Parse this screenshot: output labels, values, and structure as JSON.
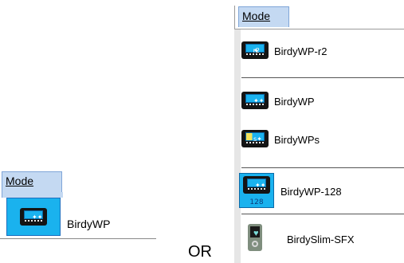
{
  "left_menu": {
    "header": "Mode",
    "item": {
      "label": "BirdyWP",
      "icon": "pager-icon"
    }
  },
  "or_text": "OR",
  "right_menu": {
    "header": "Mode",
    "items": [
      {
        "label": "BirdyWP-r2",
        "icon": "pager-r2-icon"
      },
      {
        "label": "BirdyWP",
        "icon": "pager-icon"
      },
      {
        "label": "BirdyWPs",
        "icon": "pager-s-icon"
      },
      {
        "label": "BirdyWP-128",
        "icon": "pager-128-icon",
        "badge": "128"
      },
      {
        "label": "BirdySlim-SFX",
        "icon": "slim-device-icon"
      }
    ]
  },
  "colors": {
    "menu_header_bg": "#c4d9f2",
    "selected_icon_bg": "#1ab2ee",
    "menu_gutter": "#e6e6e6"
  }
}
